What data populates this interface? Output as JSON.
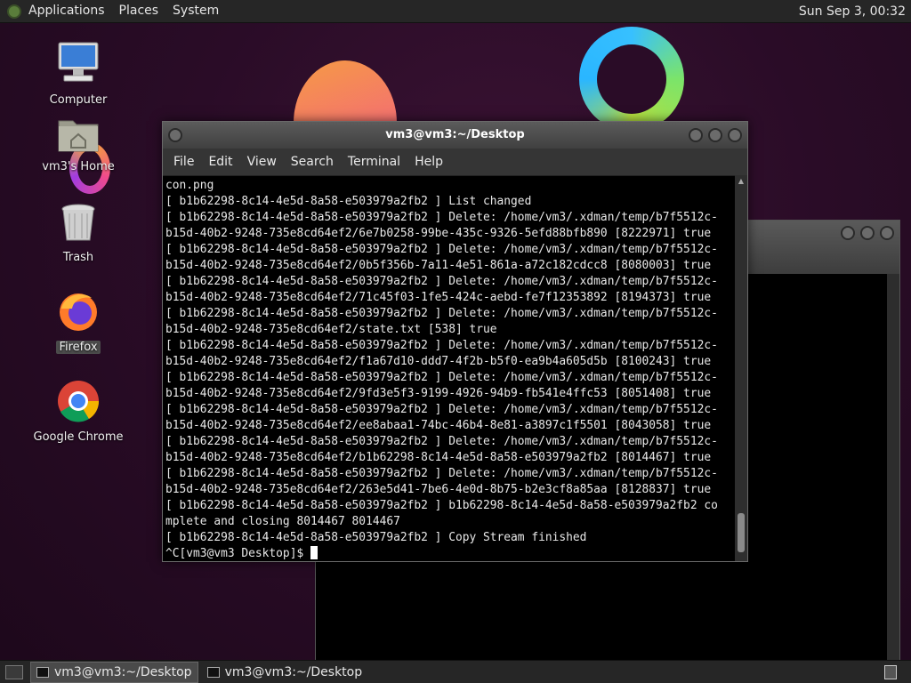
{
  "top_panel": {
    "menus": [
      "Applications",
      "Places",
      "System"
    ],
    "clock": "Sun Sep  3, 00:32"
  },
  "desktop_icons": [
    {
      "label": "Computer",
      "icon": "computer-icon"
    },
    {
      "label": "vm3's Home",
      "icon": "home-folder-icon"
    },
    {
      "label": "Trash",
      "icon": "trash-icon"
    },
    {
      "label": "Firefox",
      "icon": "firefox-icon",
      "selected": true
    },
    {
      "label": "Google Chrome",
      "icon": "chrome-icon"
    }
  ],
  "terminal": {
    "title": "vm3@vm3:~/Desktop",
    "menu": [
      "File",
      "Edit",
      "View",
      "Search",
      "Terminal",
      "Help"
    ],
    "lines": [
      "con.png",
      "[ b1b62298-8c14-4e5d-8a58-e503979a2fb2 ] List changed",
      "[ b1b62298-8c14-4e5d-8a58-e503979a2fb2 ] Delete: /home/vm3/.xdman/temp/b7f5512c-",
      "b15d-40b2-9248-735e8cd64ef2/6e7b0258-99be-435c-9326-5efd88bfb890 [8222971] true",
      "[ b1b62298-8c14-4e5d-8a58-e503979a2fb2 ] Delete: /home/vm3/.xdman/temp/b7f5512c-",
      "b15d-40b2-9248-735e8cd64ef2/0b5f356b-7a11-4e51-861a-a72c182cdcc8 [8080003] true",
      "[ b1b62298-8c14-4e5d-8a58-e503979a2fb2 ] Delete: /home/vm3/.xdman/temp/b7f5512c-",
      "b15d-40b2-9248-735e8cd64ef2/71c45f03-1fe5-424c-aebd-fe7f12353892 [8194373] true",
      "[ b1b62298-8c14-4e5d-8a58-e503979a2fb2 ] Delete: /home/vm3/.xdman/temp/b7f5512c-",
      "b15d-40b2-9248-735e8cd64ef2/state.txt [538] true",
      "[ b1b62298-8c14-4e5d-8a58-e503979a2fb2 ] Delete: /home/vm3/.xdman/temp/b7f5512c-",
      "b15d-40b2-9248-735e8cd64ef2/f1a67d10-ddd7-4f2b-b5f0-ea9b4a605d5b [8100243] true",
      "[ b1b62298-8c14-4e5d-8a58-e503979a2fb2 ] Delete: /home/vm3/.xdman/temp/b7f5512c-",
      "b15d-40b2-9248-735e8cd64ef2/9fd3e5f3-9199-4926-94b9-fb541e4ffc53 [8051408] true",
      "[ b1b62298-8c14-4e5d-8a58-e503979a2fb2 ] Delete: /home/vm3/.xdman/temp/b7f5512c-",
      "b15d-40b2-9248-735e8cd64ef2/ee8abaa1-74bc-46b4-8e81-a3897c1f5501 [8043058] true",
      "[ b1b62298-8c14-4e5d-8a58-e503979a2fb2 ] Delete: /home/vm3/.xdman/temp/b7f5512c-",
      "b15d-40b2-9248-735e8cd64ef2/b1b62298-8c14-4e5d-8a58-e503979a2fb2 [8014467] true",
      "[ b1b62298-8c14-4e5d-8a58-e503979a2fb2 ] Delete: /home/vm3/.xdman/temp/b7f5512c-",
      "b15d-40b2-9248-735e8cd64ef2/263e5d41-7be6-4e0d-8b75-b2e3cf8a85aa [8128837] true",
      "[ b1b62298-8c14-4e5d-8a58-e503979a2fb2 ] b1b62298-8c14-4e5d-8a58-e503979a2fb2 co",
      "mplete and closing 8014467 8014467",
      "[ b1b62298-8c14-4e5d-8a58-e503979a2fb2 ] Copy Stream finished"
    ],
    "prompt": "^C[vm3@vm3 Desktop]$ "
  },
  "taskbar": {
    "tasks": [
      {
        "label": "vm3@vm3:~/Desktop",
        "active": true
      },
      {
        "label": "vm3@vm3:~/Desktop",
        "active": false
      }
    ]
  }
}
